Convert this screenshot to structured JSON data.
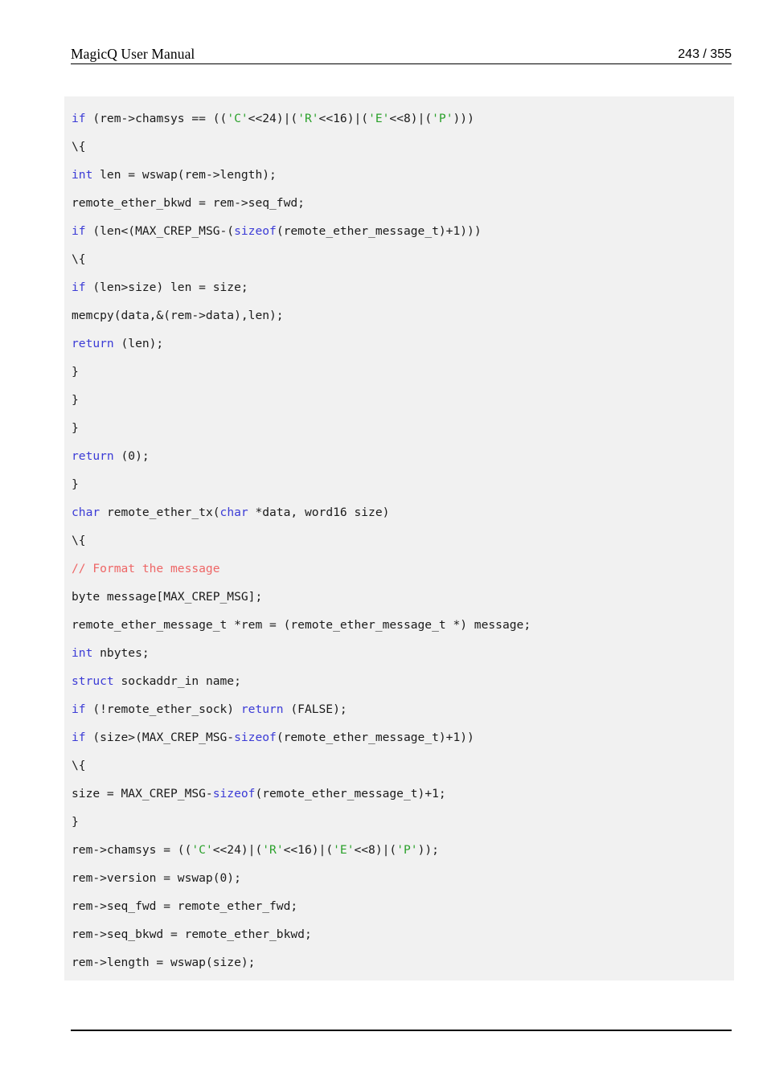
{
  "document": {
    "header": {
      "title": "MagicQ User Manual",
      "page_indicator": "243 / 355",
      "current_page": 243,
      "total_pages": 355
    },
    "colors": {
      "page_background": "#ffffff",
      "code_background": "#f1f1f1",
      "text": "#1a1a1a",
      "keyword": "#3b3bd6",
      "string": "#2aa02a",
      "comment": "#ee6666",
      "rule": "#000000"
    }
  },
  "code_block": {
    "language": "c",
    "lines": [
      {
        "index": 0,
        "text": "if (rem->chamsys == (('C'<<24)|('R'<<16)|('E'<<8)|('P')))",
        "tokens": [
          {
            "t": "if",
            "c": "kw"
          },
          {
            "t": " (rem->chamsys == ((",
            "c": "plain"
          },
          {
            "t": "'C'",
            "c": "str"
          },
          {
            "t": "<<24)|(",
            "c": "plain"
          },
          {
            "t": "'R'",
            "c": "str"
          },
          {
            "t": "<<16)|(",
            "c": "plain"
          },
          {
            "t": "'E'",
            "c": "str"
          },
          {
            "t": "<<8)|(",
            "c": "plain"
          },
          {
            "t": "'P'",
            "c": "str"
          },
          {
            "t": ")))",
            "c": "plain"
          }
        ]
      },
      {
        "index": 1,
        "text": "\\{",
        "tokens": [
          {
            "t": "\\{",
            "c": "plain"
          }
        ]
      },
      {
        "index": 2,
        "text": "int len = wswap(rem->length);",
        "tokens": [
          {
            "t": "int",
            "c": "kw"
          },
          {
            "t": " len = wswap(rem->length);",
            "c": "plain"
          }
        ]
      },
      {
        "index": 3,
        "text": "remote_ether_bkwd = rem->seq_fwd;",
        "tokens": [
          {
            "t": "remote_ether_bkwd = rem->seq_fwd;",
            "c": "plain"
          }
        ]
      },
      {
        "index": 4,
        "text": "if (len<(MAX_CREP_MSG-(sizeof(remote_ether_message_t)+1)))",
        "tokens": [
          {
            "t": "if",
            "c": "kw"
          },
          {
            "t": " (len<(MAX_CREP_MSG-(",
            "c": "plain"
          },
          {
            "t": "sizeof",
            "c": "kw"
          },
          {
            "t": "(remote_ether_message_t)+1)))",
            "c": "plain"
          }
        ]
      },
      {
        "index": 5,
        "text": "\\{",
        "tokens": [
          {
            "t": "\\{",
            "c": "plain"
          }
        ]
      },
      {
        "index": 6,
        "text": "if (len>size) len = size;",
        "tokens": [
          {
            "t": "if",
            "c": "kw"
          },
          {
            "t": " (len>size) len = size;",
            "c": "plain"
          }
        ]
      },
      {
        "index": 7,
        "text": "memcpy(data,&(rem->data),len);",
        "tokens": [
          {
            "t": "memcpy(data,&(rem->data),len);",
            "c": "plain"
          }
        ]
      },
      {
        "index": 8,
        "text": "return (len);",
        "tokens": [
          {
            "t": "return",
            "c": "kw"
          },
          {
            "t": " (len);",
            "c": "plain"
          }
        ]
      },
      {
        "index": 9,
        "text": "}",
        "tokens": [
          {
            "t": "}",
            "c": "plain"
          }
        ]
      },
      {
        "index": 10,
        "text": "}",
        "tokens": [
          {
            "t": "}",
            "c": "plain"
          }
        ]
      },
      {
        "index": 11,
        "text": "}",
        "tokens": [
          {
            "t": "}",
            "c": "plain"
          }
        ]
      },
      {
        "index": 12,
        "text": "return (0);",
        "tokens": [
          {
            "t": "return",
            "c": "kw"
          },
          {
            "t": " (0);",
            "c": "plain"
          }
        ]
      },
      {
        "index": 13,
        "text": "}",
        "tokens": [
          {
            "t": "}",
            "c": "plain"
          }
        ]
      },
      {
        "index": 14,
        "text": "char remote_ether_tx(char *data, word16 size)",
        "tokens": [
          {
            "t": "char",
            "c": "kw"
          },
          {
            "t": " remote_ether_tx(",
            "c": "plain"
          },
          {
            "t": "char",
            "c": "kw"
          },
          {
            "t": " *data, word16 size)",
            "c": "plain"
          }
        ]
      },
      {
        "index": 15,
        "text": "\\{",
        "tokens": [
          {
            "t": "\\{",
            "c": "plain"
          }
        ]
      },
      {
        "index": 16,
        "text": "// Format the message",
        "tokens": [
          {
            "t": "// Format the message",
            "c": "com"
          }
        ]
      },
      {
        "index": 17,
        "text": "byte message[MAX_CREP_MSG];",
        "tokens": [
          {
            "t": "byte message[MAX_CREP_MSG];",
            "c": "plain"
          }
        ]
      },
      {
        "index": 18,
        "text": "remote_ether_message_t *rem = (remote_ether_message_t *) message;",
        "tokens": [
          {
            "t": "remote_ether_message_t *rem = (remote_ether_message_t *) message;",
            "c": "plain"
          }
        ]
      },
      {
        "index": 19,
        "text": "int nbytes;",
        "tokens": [
          {
            "t": "int",
            "c": "kw"
          },
          {
            "t": " nbytes;",
            "c": "plain"
          }
        ]
      },
      {
        "index": 20,
        "text": "struct sockaddr_in name;",
        "tokens": [
          {
            "t": "struct",
            "c": "kw"
          },
          {
            "t": " sockaddr_in name;",
            "c": "plain"
          }
        ]
      },
      {
        "index": 21,
        "text": "if (!remote_ether_sock) return (FALSE);",
        "tokens": [
          {
            "t": "if",
            "c": "kw"
          },
          {
            "t": " (!remote_ether_sock) ",
            "c": "plain"
          },
          {
            "t": "return",
            "c": "kw"
          },
          {
            "t": " (FALSE);",
            "c": "plain"
          }
        ]
      },
      {
        "index": 22,
        "text": "if (size>(MAX_CREP_MSG-sizeof(remote_ether_message_t)+1))",
        "tokens": [
          {
            "t": "if",
            "c": "kw"
          },
          {
            "t": " (size>(MAX_CREP_MSG-",
            "c": "plain"
          },
          {
            "t": "sizeof",
            "c": "kw"
          },
          {
            "t": "(remote_ether_message_t)+1))",
            "c": "plain"
          }
        ]
      },
      {
        "index": 23,
        "text": "\\{",
        "tokens": [
          {
            "t": "\\{",
            "c": "plain"
          }
        ]
      },
      {
        "index": 24,
        "text": "size = MAX_CREP_MSG-sizeof(remote_ether_message_t)+1;",
        "tokens": [
          {
            "t": "size = MAX_CREP_MSG-",
            "c": "plain"
          },
          {
            "t": "sizeof",
            "c": "kw"
          },
          {
            "t": "(remote_ether_message_t)+1;",
            "c": "plain"
          }
        ]
      },
      {
        "index": 25,
        "text": "}",
        "tokens": [
          {
            "t": "}",
            "c": "plain"
          }
        ]
      },
      {
        "index": 26,
        "text": "rem->chamsys = (('C'<<24)|('R'<<16)|('E'<<8)|('P'));",
        "tokens": [
          {
            "t": "rem->chamsys = ((",
            "c": "plain"
          },
          {
            "t": "'C'",
            "c": "str"
          },
          {
            "t": "<<24)|(",
            "c": "plain"
          },
          {
            "t": "'R'",
            "c": "str"
          },
          {
            "t": "<<16)|(",
            "c": "plain"
          },
          {
            "t": "'E'",
            "c": "str"
          },
          {
            "t": "<<8)|(",
            "c": "plain"
          },
          {
            "t": "'P'",
            "c": "str"
          },
          {
            "t": "));",
            "c": "plain"
          }
        ]
      },
      {
        "index": 27,
        "text": "rem->version = wswap(0);",
        "tokens": [
          {
            "t": "rem->version = wswap(0);",
            "c": "plain"
          }
        ]
      },
      {
        "index": 28,
        "text": "rem->seq_fwd = remote_ether_fwd;",
        "tokens": [
          {
            "t": "rem->seq_fwd = remote_ether_fwd;",
            "c": "plain"
          }
        ]
      },
      {
        "index": 29,
        "text": "rem->seq_bkwd = remote_ether_bkwd;",
        "tokens": [
          {
            "t": "rem->seq_bkwd = remote_ether_bkwd;",
            "c": "plain"
          }
        ]
      },
      {
        "index": 30,
        "text": "rem->length = wswap(size);",
        "tokens": [
          {
            "t": "rem->length = wswap(size);",
            "c": "plain"
          }
        ]
      }
    ]
  }
}
